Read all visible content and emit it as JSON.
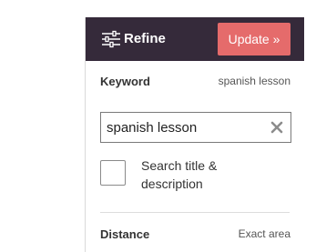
{
  "header": {
    "title": "Refine",
    "icon": "sliders-icon",
    "update_label": "Update »"
  },
  "keyword": {
    "label": "Keyword",
    "summary": "spanish lesson",
    "input_value": "spanish lesson",
    "clear_icon": "clear-x-icon"
  },
  "search_option": {
    "label": "Search title & description",
    "checked": false
  },
  "distance": {
    "label": "Distance",
    "summary": "Exact area"
  },
  "colors": {
    "header_bg": "#352a3a",
    "update_bg": "#e56b6b",
    "text": "#333333"
  }
}
